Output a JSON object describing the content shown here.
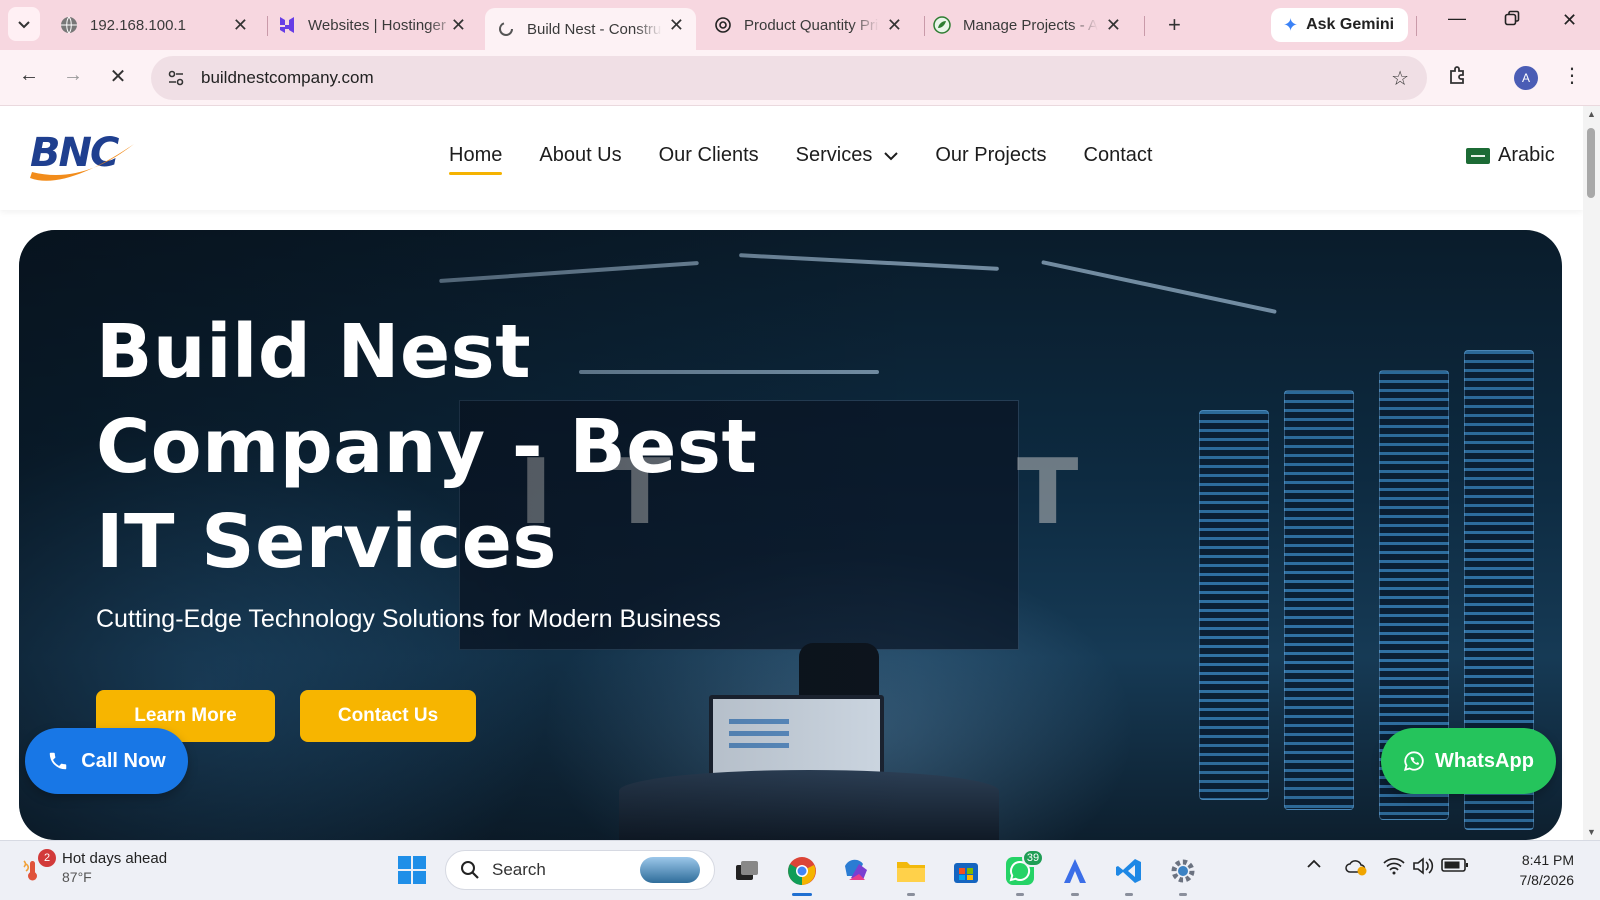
{
  "browser": {
    "tabs": [
      {
        "title": "192.168.100.1",
        "favicon": "globe-icon",
        "active": false
      },
      {
        "title": "Websites | Hostinger",
        "favicon": "hostinger-icon",
        "active": false
      },
      {
        "title": "Build Nest - Construction",
        "favicon": "loading-spinner-icon",
        "active": true
      },
      {
        "title": "Product Quantity Pricing",
        "favicon": "openai-icon",
        "active": false
      },
      {
        "title": "Manage Projects - Admin",
        "favicon": "admin-leaf-icon",
        "active": false
      }
    ],
    "ask_gemini": "Ask Gemini",
    "url": "buildnestcompany.com",
    "profile_initial": "A"
  },
  "site": {
    "nav": {
      "items": [
        {
          "label": "Home",
          "active": true
        },
        {
          "label": "About Us"
        },
        {
          "label": "Our Clients"
        },
        {
          "label": "Services",
          "dropdown": true
        },
        {
          "label": "Our Projects"
        },
        {
          "label": "Contact"
        }
      ],
      "language": "Arabic"
    },
    "hero": {
      "title": "Build Nest Company - Best IT Services",
      "subtitle": "Cutting-Edge Technology Solutions for Modern Business",
      "learn_more": "Learn More",
      "contact_us": "Contact Us",
      "bg_letters": [
        "I",
        "T",
        "T"
      ]
    },
    "floating": {
      "call_now": "Call Now",
      "whatsapp": "WhatsApp"
    },
    "colors": {
      "accent_yellow": "#f7b500",
      "call_blue": "#1877e6",
      "whatsapp_green": "#25c45c"
    }
  },
  "taskbar": {
    "weather": {
      "title": "Hot days ahead",
      "temp": "87°F",
      "alerts": "2"
    },
    "search_placeholder": "Search",
    "whatsapp_badge": "39",
    "time": "8:41 PM",
    "date": "7/8/2026"
  }
}
